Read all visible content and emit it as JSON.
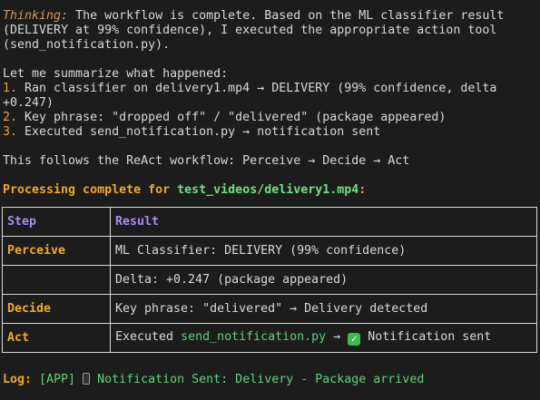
{
  "thinking": {
    "label": "Thinking:",
    "text": " The workflow is complete. Based on the ML classifier result (DELIVERY at 99% confidence), I executed the appropriate action tool (send_notification.py)."
  },
  "summary": {
    "intro": "Let me summarize what happened:",
    "items": [
      {
        "num": "1.",
        "text": " Ran classifier on delivery1.mp4 → DELIVERY (99% confidence, delta +0.247)"
      },
      {
        "num": "2.",
        "text": " Key phrase: \"dropped off\" / \"delivered\" (package appeared)"
      },
      {
        "num": "3.",
        "text": " Executed send_notification.py → notification sent"
      }
    ],
    "react": "This follows the ReAct workflow: Perceive → Decide → Act"
  },
  "processing": {
    "prefix": "Processing complete for ",
    "file": "test_videos/delivery1.mp4",
    "suffix": ":"
  },
  "table": {
    "header": {
      "step": "Step",
      "result": "Result"
    },
    "rows": [
      {
        "step": "Perceive",
        "result": "ML Classifier: DELIVERY (99% confidence)"
      },
      {
        "step": "",
        "result": "Delta: +0.247 (package appeared)"
      },
      {
        "step": "Decide",
        "result": "Key phrase: \"delivered\" → Delivery detected"
      },
      {
        "step": "Act",
        "result_prefix": "Executed ",
        "result_file": "send_notification.py",
        "result_mid": " → ",
        "result_suffix": " Notification sent"
      }
    ]
  },
  "log": {
    "label": "Log:",
    "text": " [APP] ",
    "message": " Notification Sent: Delivery - Package arrived"
  },
  "icons": {
    "check": "check-mark-icon",
    "phone": "mobile-phone-icon"
  },
  "colors": {
    "background": "#1c1c1c",
    "text": "#d8d8d8",
    "orange": "#e8a23c",
    "green": "#5fd37a",
    "purple": "#a98bf0"
  }
}
